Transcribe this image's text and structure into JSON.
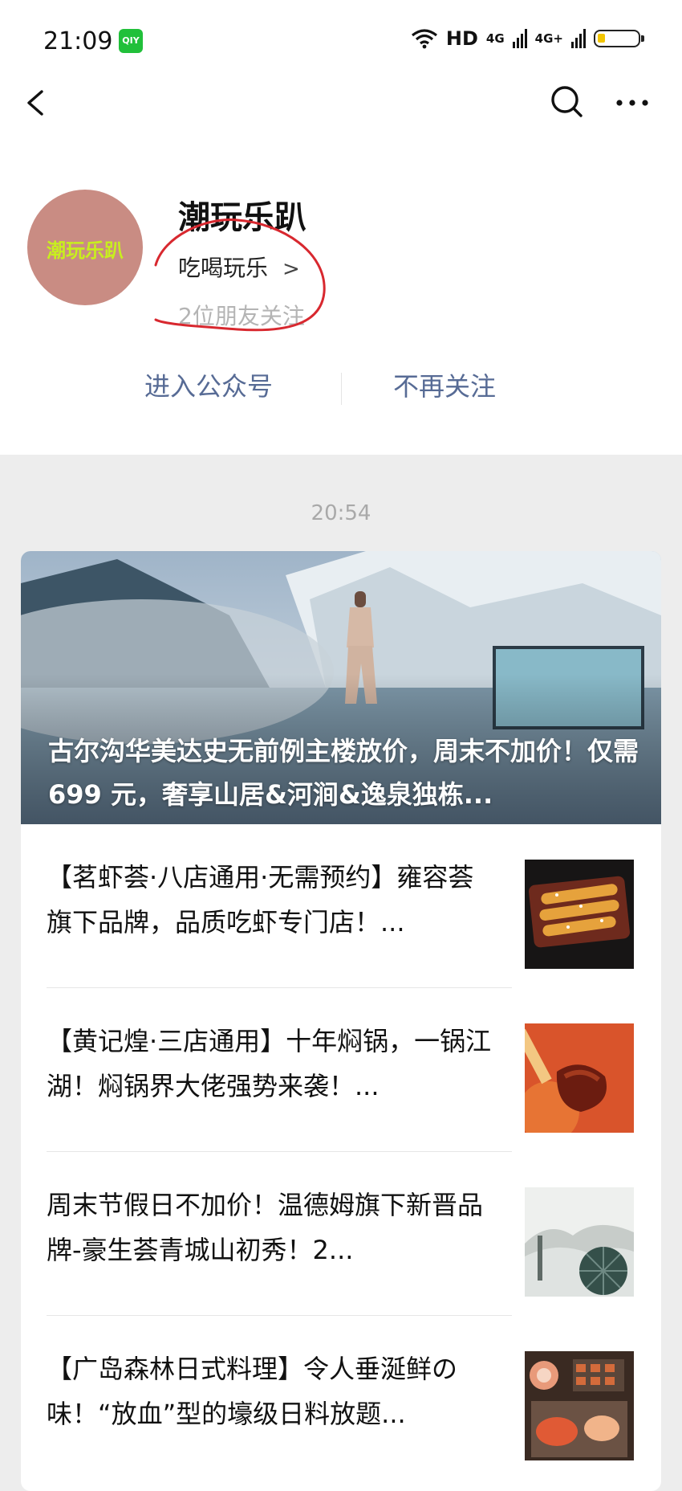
{
  "status_bar": {
    "time": "21:09",
    "app_badge": "QIY",
    "wifi_label": "HD",
    "signal1": "4G",
    "signal2": "4G+"
  },
  "nav": {
    "back_icon": "chevron-left-icon",
    "search_icon": "search-icon",
    "more_icon": "more-dots-icon"
  },
  "profile": {
    "avatar_text": "潮玩乐趴",
    "name": "潮玩乐趴",
    "category": "吃喝玩乐",
    "category_chevron": ">",
    "friends": "2位朋友关注"
  },
  "actions": {
    "enter": "进入公众号",
    "unfollow": "不再关注"
  },
  "feed": {
    "timestamp": "20:54",
    "hero_title": "古尔沟华美达史无前例主楼放价，周末不加价！仅需 699 元，奢享山居&河涧&逸泉独栋...",
    "articles": [
      {
        "title": "【茗虾荟·八店通用·无需预约】雍容荟旗下品牌，品质吃虾专门店！..."
      },
      {
        "title": "【黄记煌·三店通用】十年焖锅，一锅江湖！焖锅界大佬强势来袭！..."
      },
      {
        "title": "周末节假日不加价！温德姆旗下新晋品牌-豪生荟青城山初秀！2..."
      },
      {
        "title": "【广岛森林日式料理】令人垂涎鲜の味！“放血”型的壕级日料放题..."
      }
    ]
  },
  "colors": {
    "link": "#576b95",
    "muted": "#b4b4b4",
    "background": "#ededed",
    "avatar": "#c98c83",
    "annotation": "#d8282f"
  }
}
